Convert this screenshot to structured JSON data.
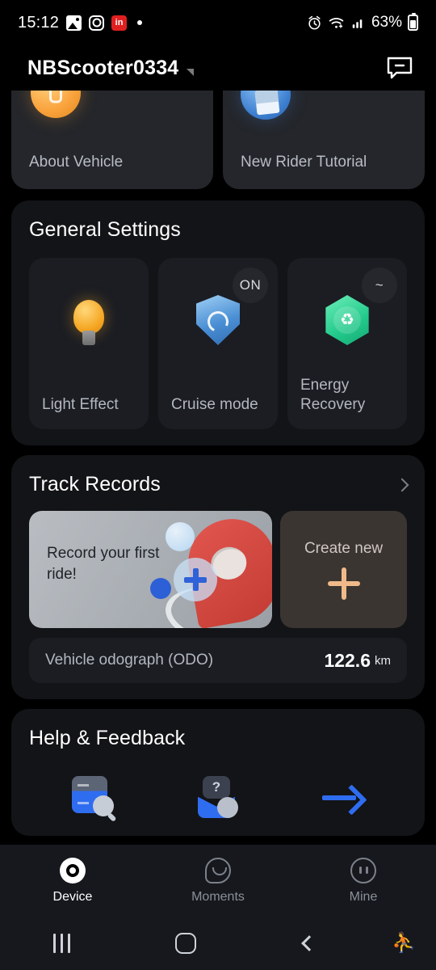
{
  "status_bar": {
    "time": "15:12",
    "left_icons": [
      "photos-icon",
      "instagram-icon",
      "linkedin-icon",
      "dot-indicator-icon"
    ],
    "linkedin_label": "in",
    "right_icons": [
      "alarm-icon",
      "wifi-icon",
      "signal-icon",
      "battery-icon"
    ],
    "battery_percent": "63%"
  },
  "header": {
    "title": "NBScooter0334",
    "caret_icon": "triangle-caret-icon",
    "action_icon": "chat-minus-icon"
  },
  "top_cards": [
    {
      "label": "About Vehicle",
      "icon": "coin-info-icon"
    },
    {
      "label": "New Rider Tutorial",
      "icon": "document-tutorial-icon"
    }
  ],
  "general_settings": {
    "title": "General Settings",
    "tiles": [
      {
        "label": "Light Effect",
        "icon": "lightbulb-icon",
        "badge": ""
      },
      {
        "label": "Cruise mode",
        "icon": "shield-speedometer-icon",
        "badge": "ON"
      },
      {
        "label": "Energy Recovery",
        "icon": "hexagon-recycle-icon",
        "badge": "~"
      }
    ]
  },
  "track_records": {
    "title": "Track Records",
    "chevron_icon": "chevron-right-icon",
    "promo": {
      "text": "Record your first ride!",
      "illustration": "map-pin-illustration"
    },
    "create_new": {
      "label": "Create new",
      "icon": "plus-icon"
    },
    "odometer": {
      "label": "Vehicle odograph (ODO)",
      "value": "122.6",
      "unit": "km"
    }
  },
  "help_feedback": {
    "title": "Help & Feedback",
    "items": [
      {
        "icon": "faq-search-icon"
      },
      {
        "icon": "feedback-mail-icon"
      },
      {
        "icon": "arrow-right-icon"
      }
    ]
  },
  "bottom_nav": {
    "items": [
      {
        "label": "Device",
        "icon": "device-circle-icon",
        "active": true
      },
      {
        "label": "Moments",
        "icon": "chat-smile-icon",
        "active": false
      },
      {
        "label": "Mine",
        "icon": "profile-circle-icon",
        "active": false
      }
    ]
  },
  "system_nav": {
    "recent_icon": "recents-icon",
    "home_icon": "home-icon",
    "back_icon": "back-icon",
    "accessibility_icon": "accessibility-icon"
  },
  "colors": {
    "background": "#000000",
    "card": "#131417",
    "tile": "#1b1d23",
    "accent_blue": "#2f6df0",
    "accent_orange": "#f0b98a",
    "accent_green": "#22c98b",
    "nav_bar": "#16181e"
  }
}
